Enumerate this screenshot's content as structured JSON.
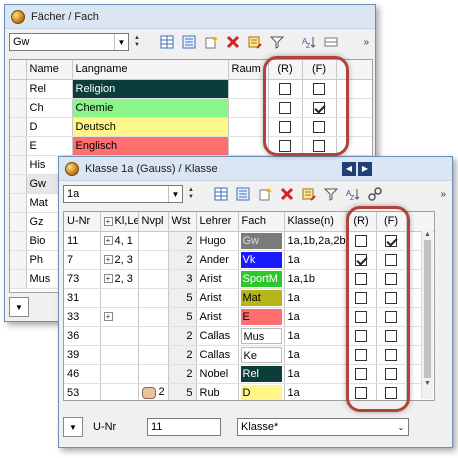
{
  "back_window": {
    "title": "Fächer / Fach",
    "combo_value": "Gw",
    "columns": [
      "Name",
      "Langname",
      "Raum",
      "(R)",
      "(F)"
    ],
    "rows": [
      {
        "name": "Rel",
        "langname": "Religion",
        "color": "#0b3d3a",
        "text_color": "#ffffff",
        "r": false,
        "f": false
      },
      {
        "name": "Ch",
        "langname": "Chemie",
        "color": "#8af58a",
        "text_color": "#000000",
        "r": false,
        "f": true
      },
      {
        "name": "D",
        "langname": "Deutsch",
        "color": "#fff68a",
        "text_color": "#000000",
        "r": false,
        "f": false
      },
      {
        "name": "E",
        "langname": "Englisch",
        "color": "#ff6f6f",
        "text_color": "#000000",
        "r": false,
        "f": false
      },
      {
        "name": "His",
        "langname": "",
        "color": "",
        "text_color": "#000000"
      },
      {
        "name": "Gw",
        "langname": "",
        "color": "",
        "text_color": "#000000"
      },
      {
        "name": "Mat",
        "langname": "",
        "color": "",
        "text_color": "#000000"
      },
      {
        "name": "Gz",
        "langname": "",
        "color": "",
        "text_color": "#000000"
      },
      {
        "name": "Bio",
        "langname": "",
        "color": "",
        "text_color": "#000000"
      },
      {
        "name": "Ph",
        "langname": "",
        "color": "",
        "text_color": "#000000"
      },
      {
        "name": "Mus",
        "langname": "",
        "color": "",
        "text_color": "#000000"
      }
    ],
    "checked_r": "☑"
  },
  "front_window": {
    "title": "Klasse 1a (Gauss) / Klasse",
    "combo_value": "1a",
    "columns": [
      "U-Nr",
      "Kl,Le",
      "Nvpl",
      "Wst",
      "Lehrer",
      "Fach",
      "Klasse(n)",
      "(R)",
      "(F)"
    ],
    "rows": [
      {
        "unr": "11",
        "klle": "4, 1",
        "klle_plus": true,
        "nvpl": "",
        "wst": "2",
        "lehrer": "Hugo",
        "fach": "Gw",
        "fach_color": "#7b7b7b",
        "fach_text": "#dddddd",
        "klassen": "1a,1b,2a,2b",
        "r": false,
        "f": true
      },
      {
        "unr": "7",
        "klle": "2, 3",
        "klle_plus": true,
        "nvpl": "",
        "wst": "2",
        "lehrer": "Ander",
        "fach": "Vk",
        "fach_color": "#1a1aff",
        "fach_text": "#ffffff",
        "klassen": "1a",
        "r": true,
        "f": false
      },
      {
        "unr": "73",
        "klle": "2, 3",
        "klle_plus": true,
        "nvpl": "",
        "wst": "3",
        "lehrer": "Arist",
        "fach": "SportM",
        "fach_color": "#2cc72c",
        "fach_text": "#ffffff",
        "klassen": "1a,1b",
        "r": false,
        "f": false
      },
      {
        "unr": "31",
        "klle": "",
        "klle_plus": false,
        "nvpl": "",
        "wst": "5",
        "lehrer": "Arist",
        "fach": "Mat",
        "fach_color": "#b5b51a",
        "fach_text": "#000000",
        "klassen": "1a",
        "r": false,
        "f": false
      },
      {
        "unr": "33",
        "klle": "",
        "klle_plus": true,
        "nvpl": "",
        "wst": "5",
        "lehrer": "Arist",
        "fach": "E",
        "fach_color": "#ff6f6f",
        "fach_text": "#000000",
        "klassen": "1a",
        "r": false,
        "f": false
      },
      {
        "unr": "36",
        "klle": "",
        "klle_plus": false,
        "nvpl": "",
        "wst": "2",
        "lehrer": "Callas",
        "fach": "Mus",
        "fach_color": "#ffffff",
        "fach_text": "#000000",
        "klassen": "1a",
        "r": false,
        "f": false
      },
      {
        "unr": "39",
        "klle": "",
        "klle_plus": false,
        "nvpl": "",
        "wst": "2",
        "lehrer": "Callas",
        "fach": "Ke",
        "fach_color": "#ffffff",
        "fach_text": "#000000",
        "klassen": "1a",
        "r": false,
        "f": false
      },
      {
        "unr": "46",
        "klle": "",
        "klle_plus": false,
        "nvpl": "",
        "wst": "2",
        "lehrer": "Nobel",
        "fach": "Rel",
        "fach_color": "#0b3d3a",
        "fach_text": "#ffffff",
        "klassen": "1a",
        "r": false,
        "f": false
      },
      {
        "unr": "53",
        "klle": "",
        "klle_plus": false,
        "nvpl": "2",
        "wst": "5",
        "lehrer": "Rub",
        "fach": "D",
        "fach_color": "#fff68a",
        "fach_text": "#000000",
        "klassen": "1a",
        "r": false,
        "f": false
      }
    ],
    "footer_label": "U-Nr",
    "footer_value": "11",
    "footer_combo": "Klasse*"
  },
  "accent_color": "#b0433a"
}
